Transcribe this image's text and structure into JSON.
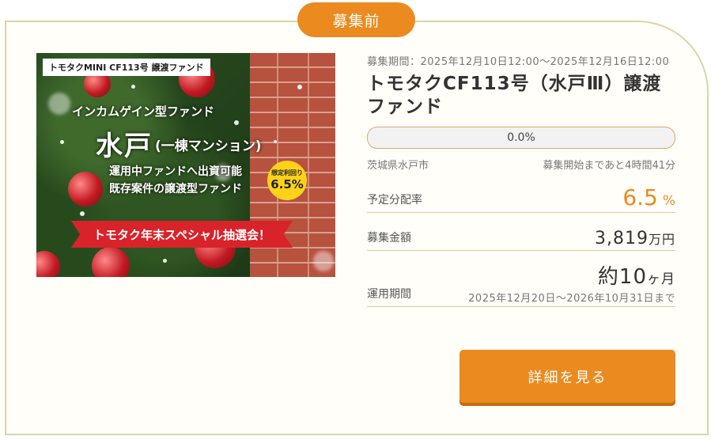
{
  "status_tab": "募集前",
  "thumbnail": {
    "label_top": "トモタクMINI CF113号 譲渡ファンド",
    "line1": "インカムゲイン型ファンド",
    "city": "水戸",
    "building": "(一棟マンション)",
    "line3a": "運用中ファンドへ出資可能",
    "line3b": "既存案件の譲渡型ファンド",
    "badge_label": "想定利回り",
    "badge_value": "6.5%",
    "ribbon": "トモタク年末スペシャル抽選会！"
  },
  "fund": {
    "period": "募集期間：2025年12月10日12:00〜2025年12月16日12:00",
    "title": "トモタクCF113号（水戸Ⅲ）譲渡ファンド",
    "progress_text": "0.0%",
    "progress_fraction": 0.0,
    "location": "茨城県水戸市",
    "countdown": "募集開始まであと4時間41分",
    "yield_label": "予定分配率",
    "yield_value": "6.5",
    "yield_unit": "%",
    "amount_label": "募集金額",
    "amount_value": "3,819",
    "amount_unit": "万円",
    "term_label": "運用期間",
    "term_prefix": "約",
    "term_value": "10",
    "term_unit": "ヶ月",
    "term_dates": "2025年12月20日〜2026年10月31日まで"
  },
  "detail_button": "詳細を見る",
  "colors": {
    "accent": "#ea8a1f",
    "border": "#ddd3a6"
  }
}
